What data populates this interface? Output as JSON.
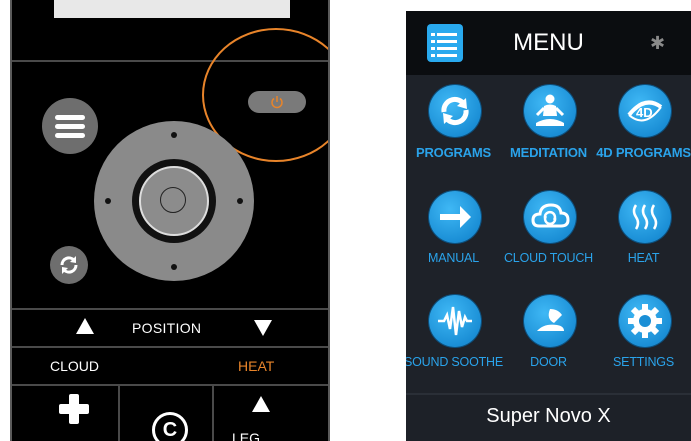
{
  "remote": {
    "position_label": "POSITION",
    "cloud_label": "CLOUD",
    "heat_label": "HEAT",
    "bottom_partial_text": "LEG",
    "c_symbol": "C",
    "highlight_color": "#e8842a",
    "icons": [
      "menu-icon",
      "power-icon",
      "sync-icon",
      "arrow-up-icon",
      "arrow-down-icon",
      "plus-icon"
    ]
  },
  "phone": {
    "title": "MENU",
    "bluetooth_icon": "bluetooth-icon",
    "footer": "Super Novo X",
    "accent_color": "#2aa3ea",
    "items": [
      {
        "label": "PROGRAMS",
        "icon": "sync-arrows-icon"
      },
      {
        "label": "MEDITATION",
        "icon": "meditation-icon"
      },
      {
        "label": "4D PROGRAMS",
        "icon": "4d-icon"
      },
      {
        "label": "MANUAL",
        "icon": "arrow-right-icon"
      },
      {
        "label": "CLOUD TOUCH",
        "icon": "cloud-touch-icon"
      },
      {
        "label": "HEAT",
        "icon": "heat-waves-icon"
      },
      {
        "label": "SOUND SOOTHE",
        "icon": "sound-wave-icon"
      },
      {
        "label": "DOOR",
        "icon": "door-icon"
      },
      {
        "label": "SETTINGS",
        "icon": "gear-icon"
      }
    ]
  }
}
